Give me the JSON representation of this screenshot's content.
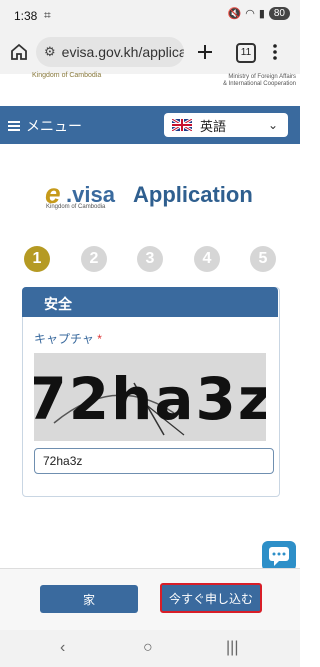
{
  "status": {
    "time": "1:38",
    "battery": "80"
  },
  "browser": {
    "url": "evisa.gov.kh/applica",
    "tab_count": "11"
  },
  "header": {
    "kingdom_text": "Kingdom of Cambodia",
    "ministry_line1": "Ministry of Foreign Affairs",
    "ministry_line2": "& International Cooperation"
  },
  "nav": {
    "menu_label": "メニュー",
    "language_label": "英語"
  },
  "logo": {
    "e": "e",
    "visa": ".visa",
    "subtitle": "Kingdom of Cambodia",
    "title": "Application"
  },
  "steps": [
    "1",
    "2",
    "3",
    "4",
    "5"
  ],
  "card": {
    "title": "安全",
    "captcha_label": "キャプチャ",
    "required_mark": "*",
    "captcha_text": "72ha3z",
    "input_value": "72ha3z"
  },
  "actions": {
    "home_label": "家",
    "apply_label": "今すぐ申し込む"
  },
  "colors": {
    "primary": "#3a6a9e",
    "step_active": "#b59a23",
    "step_inactive": "#d6d6d6",
    "highlight_border": "#d81e28"
  }
}
